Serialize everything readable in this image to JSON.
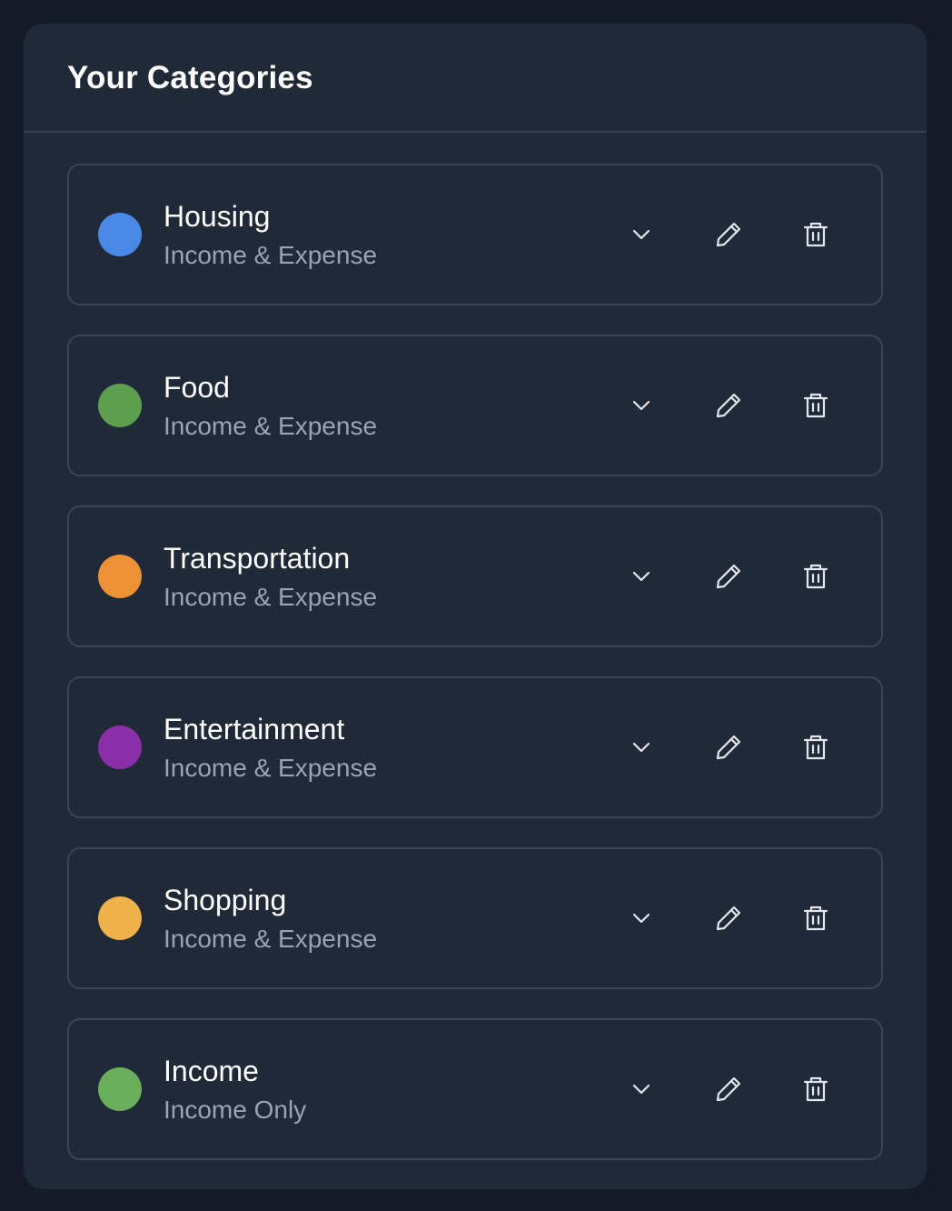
{
  "panel": {
    "title": "Your Categories"
  },
  "categories": [
    {
      "name": "Housing",
      "type": "Income & Expense",
      "color": "#4a8ae6"
    },
    {
      "name": "Food",
      "type": "Income & Expense",
      "color": "#5e9e4f"
    },
    {
      "name": "Transportation",
      "type": "Income & Expense",
      "color": "#ec9136"
    },
    {
      "name": "Entertainment",
      "type": "Income & Expense",
      "color": "#8b2fa8"
    },
    {
      "name": "Shopping",
      "type": "Income & Expense",
      "color": "#efb24a"
    },
    {
      "name": "Income",
      "type": "Income Only",
      "color": "#6aae5c"
    }
  ],
  "icons": {
    "expand": "chevron-down-icon",
    "edit": "pencil-icon",
    "delete": "trash-icon"
  },
  "colors": {
    "background": "#141a28",
    "panel": "#202938",
    "border": "#394557",
    "icon": "#e3e6ec",
    "secondary_text": "#9aa3b1"
  }
}
